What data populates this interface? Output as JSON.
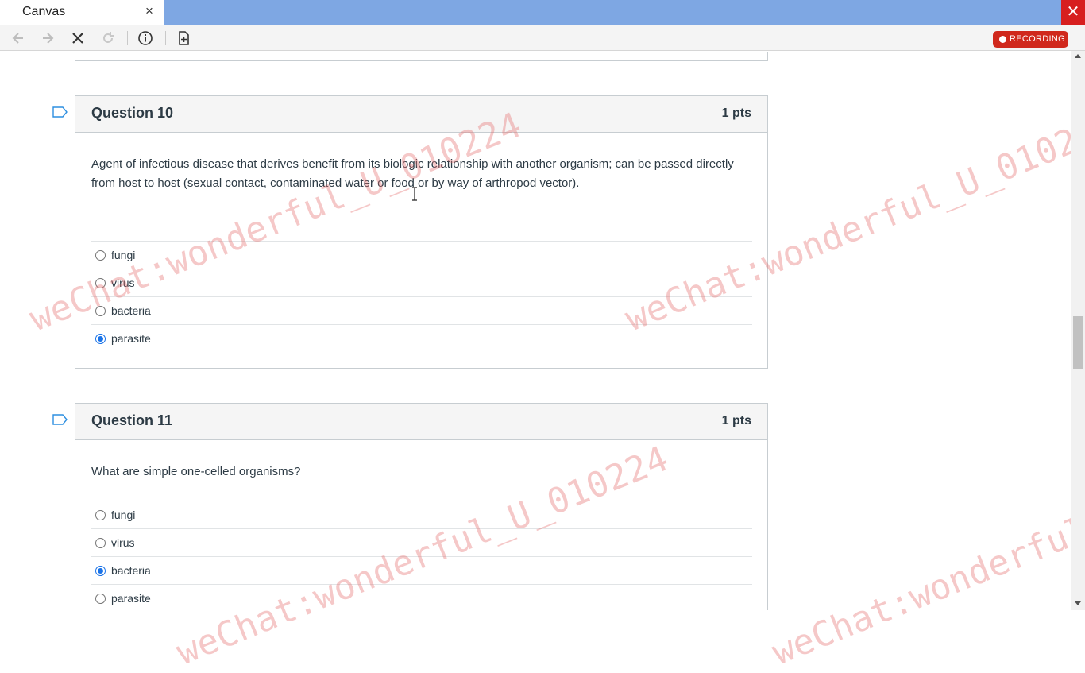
{
  "window": {
    "tab_title": "Canvas",
    "tab_close": "×",
    "close": "✕"
  },
  "toolbar": {
    "recording_label": "RECORDING"
  },
  "questions": [
    {
      "title": "Question 10",
      "points": "1 pts",
      "text": "Agent of infectious disease that derives benefit from its biologic relationship with another organism; can be passed directly from host to host (sexual contact, contaminated water or food or by way of arthropod vector).",
      "answers": [
        {
          "label": "fungi",
          "selected": false
        },
        {
          "label": "virus",
          "selected": false
        },
        {
          "label": "bacteria",
          "selected": false
        },
        {
          "label": "parasite",
          "selected": true
        }
      ]
    },
    {
      "title": "Question 11",
      "points": "1 pts",
      "text": "What are simple one-celled organisms?",
      "answers": [
        {
          "label": "fungi",
          "selected": false
        },
        {
          "label": "virus",
          "selected": false
        },
        {
          "label": "bacteria",
          "selected": true
        },
        {
          "label": "parasite",
          "selected": false
        }
      ]
    }
  ],
  "watermark": {
    "text": "weChat:wonderful_U_010224"
  },
  "colors": {
    "titlebar": "#7ea7e3",
    "recording": "#d0281c",
    "radio_selected": "#1a73e8",
    "close": "#d71f1f"
  }
}
